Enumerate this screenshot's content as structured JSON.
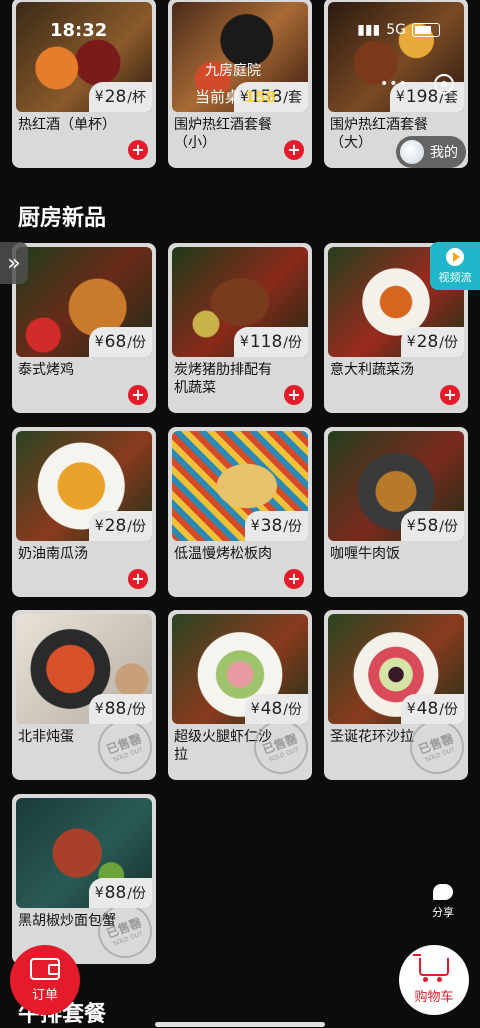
{
  "status_bar": {
    "time": "18:32",
    "network": "5G"
  },
  "overlay": {
    "title": "九房庭院",
    "current_prefix": "当前桌",
    "current_suffix": "158"
  },
  "mine": {
    "label": "我的"
  },
  "video_flow": {
    "label": "视频流"
  },
  "sections": {
    "kitchen_new": "厨房新品",
    "steak_set": "牛排套餐"
  },
  "currency": "¥",
  "sold_out": {
    "cn": "已售罄",
    "en": "SOLD OUT"
  },
  "items_top": [
    {
      "name": "热红酒（单杯）",
      "price": "28",
      "unit": "/杯",
      "image": "mulled-wine-photo",
      "sold_out": false
    },
    {
      "name": "围炉热红酒套餐（小）",
      "price": "158",
      "unit": "/套",
      "image": "mulled-wine-set-small-photo",
      "sold_out": false
    },
    {
      "name": "围炉热红酒套餐（大）",
      "price": "198",
      "unit": "/套",
      "image": "mulled-wine-set-large-photo",
      "sold_out": false
    }
  ],
  "items_new": [
    {
      "name": "泰式烤鸡",
      "price": "68",
      "unit": "/份",
      "image": "thai-roast-chicken-photo",
      "sold_out": false
    },
    {
      "name": "炭烤猪肋排配有机蔬菜",
      "price": "118",
      "unit": "/份",
      "image": "grilled-pork-ribs-photo",
      "sold_out": false
    },
    {
      "name": "意大利蔬菜汤",
      "price": "28",
      "unit": "/份",
      "image": "minestrone-soup-photo",
      "sold_out": false
    },
    {
      "name": "奶油南瓜汤",
      "price": "28",
      "unit": "/份",
      "image": "pumpkin-soup-photo",
      "sold_out": false
    },
    {
      "name": "低温慢烤松板肉",
      "price": "38",
      "unit": "/份",
      "image": "slow-roasted-pork-photo",
      "sold_out": false
    },
    {
      "name": "咖喱牛肉饭",
      "price": "58",
      "unit": "/份",
      "image": "beef-curry-rice-photo",
      "sold_out": false
    },
    {
      "name": "北非炖蛋",
      "price": "88",
      "unit": "/份",
      "image": "shakshuka-photo",
      "sold_out": true
    },
    {
      "name": "超级火腿虾仁沙拉",
      "price": "48",
      "unit": "/份",
      "image": "ham-shrimp-salad-photo",
      "sold_out": true
    },
    {
      "name": "圣诞花环沙拉",
      "price": "48",
      "unit": "/份",
      "image": "christmas-wreath-salad-photo",
      "sold_out": true
    },
    {
      "name": "黑胡椒炒面包蟹",
      "price": "88",
      "unit": "/份",
      "image": "black-pepper-crab-photo",
      "sold_out": true
    }
  ],
  "share": {
    "label": "分享"
  },
  "order": {
    "label": "订单"
  },
  "cart": {
    "label": "购物车"
  },
  "colors": {
    "accent": "#e31b2a",
    "card": "#d9d9d9",
    "background": "#0d0b0b"
  }
}
